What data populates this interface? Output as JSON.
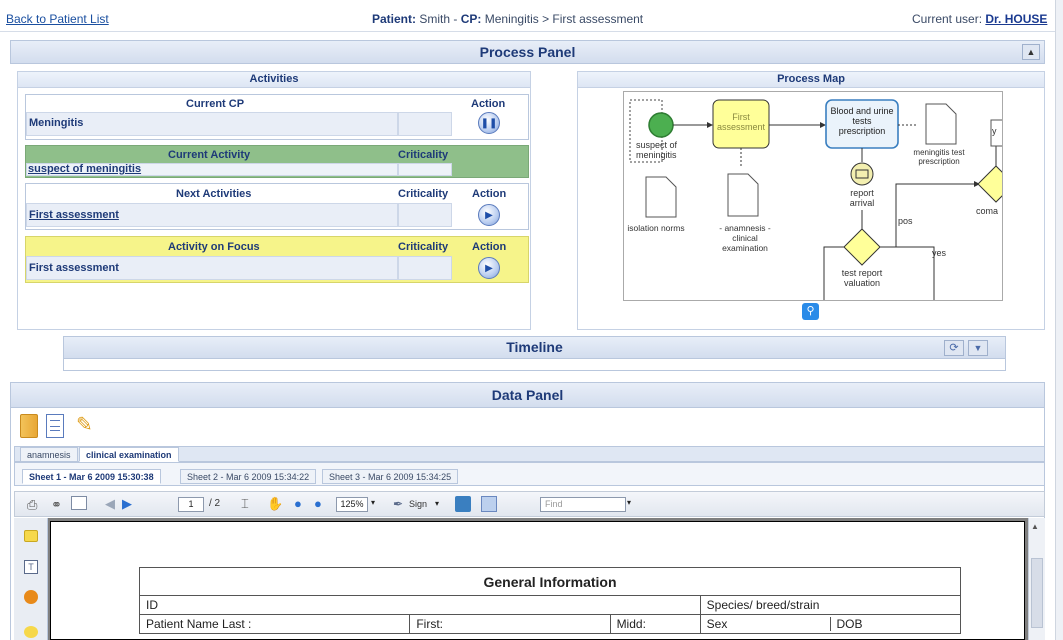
{
  "topbar": {
    "back_link": "Back to Patient List",
    "patient_label": "Patient:",
    "patient_name": "Smith",
    "cp_label": "CP:",
    "cp_path": "Meningitis > First assessment",
    "user_label": "Current user:",
    "user_name": "Dr. HOUSE"
  },
  "process_panel": {
    "title": "Process Panel",
    "activities": {
      "title": "Activities",
      "current_cp_header": "Current CP",
      "action_header": "Action",
      "current_cp_value": "Meningitis",
      "current_activity_header": "Current Activity",
      "criticality_header": "Criticality",
      "current_activity_value": "suspect of meningitis",
      "next_activities_header": "Next Activities",
      "next_activity_value": "First assessment",
      "focus_header": "Activity on Focus",
      "focus_value": "First assessment"
    },
    "process_map": {
      "title": "Process Map",
      "nodes": {
        "start": "suspect of meningitis",
        "first_assessment": "First assessment",
        "blood_urine": "Blood and urine tests prescription",
        "meningitis_test": "meningitis test prescription",
        "isolation": "isolation norms",
        "anamnesis": "- anamnesis - clinical examination",
        "report_arrival": "report arrival",
        "test_report": "test report valuation",
        "coma": "coma",
        "pos": "pos",
        "yes1": "yes",
        "y": "y"
      }
    },
    "timeline": {
      "title": "Timeline"
    }
  },
  "data_panel": {
    "title": "Data Panel",
    "tabs": [
      "anamnesis",
      "clinical examination"
    ],
    "active_tab": "clinical examination",
    "sheets": [
      "Sheet 1 - Mar 6 2009 15:30:38",
      "Sheet 2 - Mar 6 2009 15:34:22",
      "Sheet 3 - Mar 6 2009 15:34:25"
    ],
    "viewer": {
      "page_current": "1",
      "page_total": "/ 2",
      "zoom": "125%",
      "sign_label": "Sign",
      "find_placeholder": "Find"
    },
    "form": {
      "title": "General Information",
      "id_label": "ID",
      "species_label": "Species/ breed/strain",
      "name_label": "Patient Name  Last :",
      "first_label": "First:",
      "midd_label": "Midd:",
      "sex_label": "Sex",
      "dob_label": "DOB"
    }
  },
  "colors": {
    "accent": "#1e3a78",
    "current_activity_green": "#8fbf8a",
    "focus_yellow": "#f6f48a",
    "task_yellow": "#ffff99",
    "task_blue_border": "#3a7fc0"
  }
}
